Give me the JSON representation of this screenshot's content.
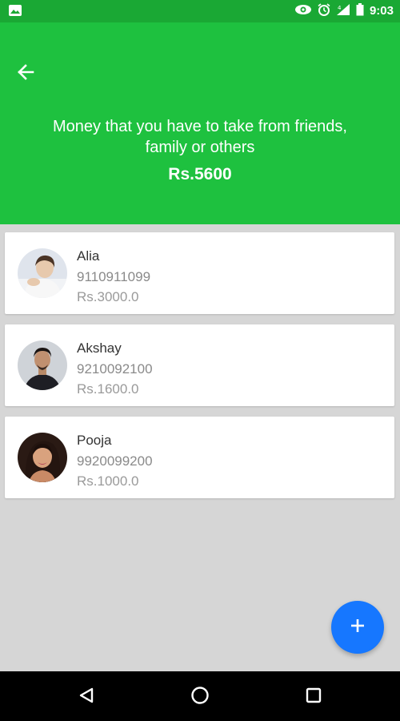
{
  "status_bar": {
    "time": "9:03",
    "icons": [
      "image-notification-icon",
      "eye-icon",
      "alarm-icon",
      "signal-icon",
      "battery-icon"
    ]
  },
  "header": {
    "back_icon": "arrow-left-icon",
    "title": "Money that you have to take from friends, family or others",
    "total": "Rs.5600",
    "background": "#1ec13f"
  },
  "contacts": [
    {
      "name": "Alia",
      "phone": "9110911099",
      "amount": "Rs.3000.0"
    },
    {
      "name": "Akshay",
      "phone": "9210092100",
      "amount": "Rs.1600.0"
    },
    {
      "name": "Pooja",
      "phone": "9920099200",
      "amount": "Rs.1000.0"
    }
  ],
  "fab": {
    "icon": "plus-icon",
    "color": "#1677ff"
  },
  "nav_bar": {
    "icons": [
      "back-triangle-icon",
      "home-circle-icon",
      "recents-square-icon"
    ]
  }
}
